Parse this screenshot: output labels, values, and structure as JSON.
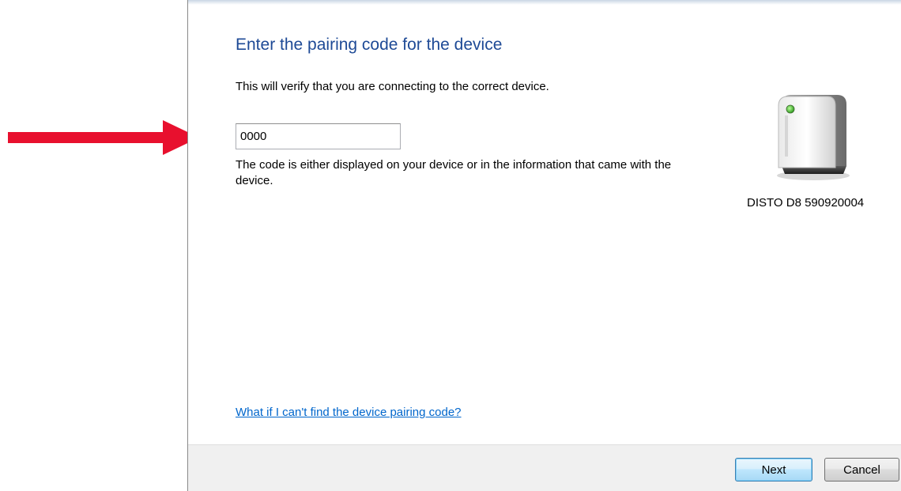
{
  "dialog": {
    "title": "Enter the pairing code for the device",
    "subtitle": "This will verify that you are connecting to the correct device.",
    "code_input": {
      "value": "0000"
    },
    "help_text": "The code is either displayed on your device or in the information that came with the device.",
    "device": {
      "name": "DISTO D8 590920004",
      "icon": "device-icon"
    },
    "help_link": "What if I can't find the device pairing code?",
    "buttons": {
      "next": "Next",
      "cancel": "Cancel"
    }
  },
  "annotation": {
    "arrow_color": "#e8102e"
  },
  "colors": {
    "title": "#1e4a96",
    "link": "#0066cc",
    "footer_bg": "#f0f0f0"
  }
}
